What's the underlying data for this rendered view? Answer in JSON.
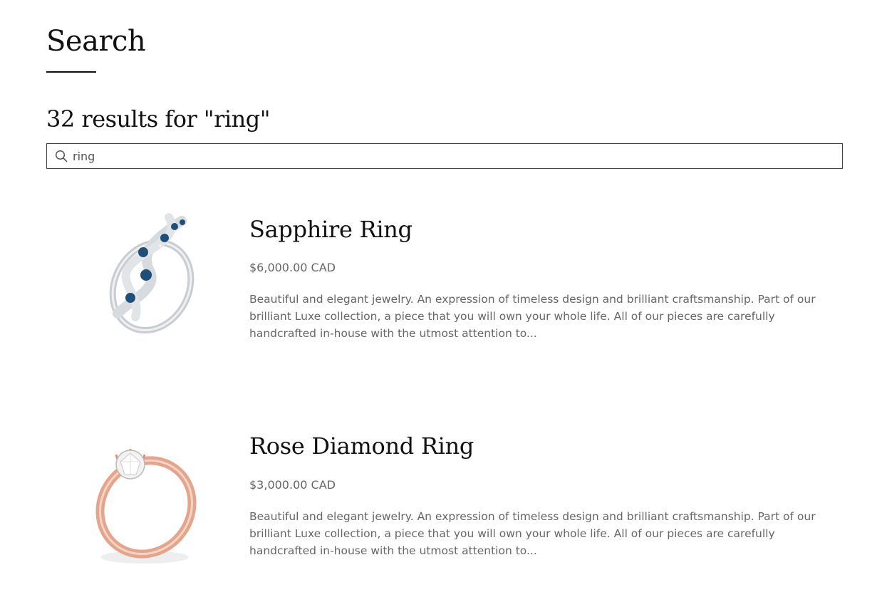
{
  "page": {
    "title": "Search",
    "results_heading": "32 results for \"ring\""
  },
  "search": {
    "value": "ring",
    "icon": "search-icon"
  },
  "results": [
    {
      "name": "Sapphire Ring",
      "price": "$6,000.00 CAD",
      "description": "Beautiful and elegant jewelry. An expression of timeless design and brilliant craftsmanship. Part of our brilliant Luxe collection, a piece that you will own your whole life.  All of our pieces are carefully handcrafted in-house with the utmost attention to...",
      "image": "sapphire-ring-image",
      "band_color": "#c9ccd1",
      "stone_color": "#1f4e79"
    },
    {
      "name": "Rose Diamond Ring",
      "price": "$3,000.00 CAD",
      "description": "Beautiful and elegant jewelry. An expression of timeless design and brilliant craftsmanship. Part of our brilliant Luxe collection, a piece that you will own your whole life.  All of our pieces are carefully handcrafted in-house with the utmost attention to...",
      "image": "rose-diamond-ring-image",
      "band_color": "#e3a58c",
      "stone_color": "#f2f2f2"
    }
  ]
}
